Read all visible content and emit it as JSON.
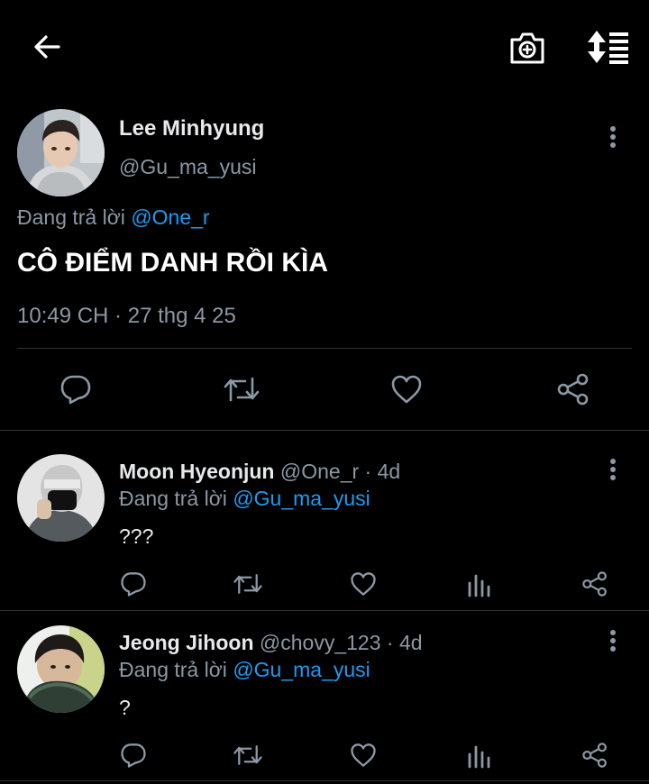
{
  "main_tweet": {
    "author_name": "Lee Minhyung",
    "author_handle": "@Gu_ma_yusi",
    "replying_prefix": "Đang trả lời",
    "replying_to": "@One_r",
    "text": "CÔ ĐIỂM DANH RỒI KÌA",
    "timestamp": "10:49 CH · 27 thg 4 25"
  },
  "replies": [
    {
      "author_name": "Moon Hyeonjun",
      "author_handle": "@One_r",
      "age": "· 4d",
      "replying_prefix": "Đang trả lời",
      "replying_to": "@Gu_ma_yusi",
      "text": "???"
    },
    {
      "author_name": "Jeong Jihoon",
      "author_handle": "@chovy_123",
      "age": "· 4d",
      "replying_prefix": "Đang trả lời",
      "replying_to": "@Gu_ma_yusi",
      "text": "?"
    }
  ],
  "icons": {
    "back": "back-arrow-icon",
    "camera": "camera-plus-icon",
    "sort": "sort-list-icon",
    "more": "more-vertical-icon",
    "reply": "reply-bubble-icon",
    "retweet": "retweet-icon",
    "like": "heart-icon",
    "analytics": "analytics-bars-icon",
    "share": "share-icon"
  },
  "colors": {
    "background": "#000000",
    "text": "#e7e9ea",
    "muted": "#8b98a5",
    "link": "#1d9bf0",
    "divider": "#2f3336"
  }
}
